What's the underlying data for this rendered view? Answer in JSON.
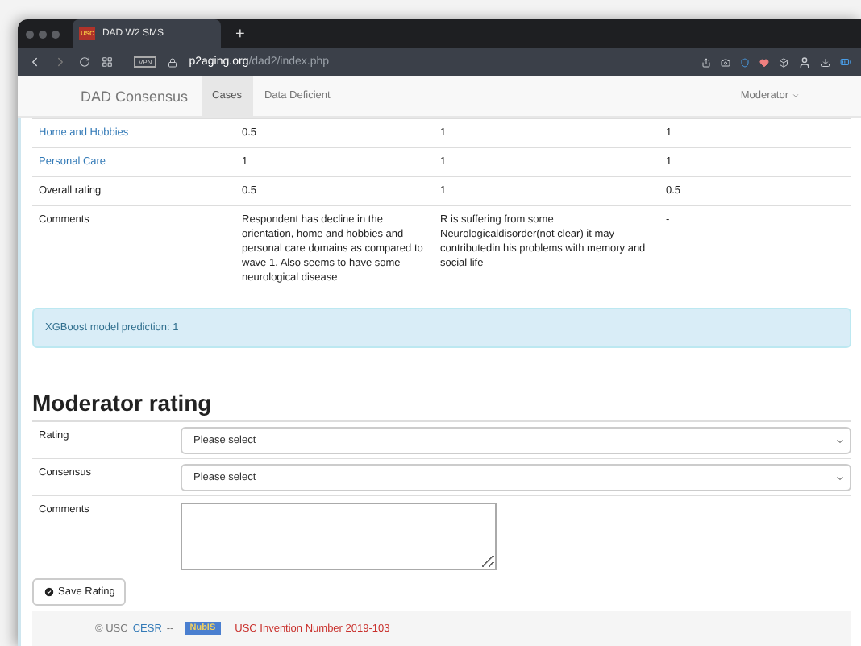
{
  "browser": {
    "favicon": "USC",
    "tab_title": "DAD W2 SMS",
    "new_tab": "+",
    "vpn": "VPN",
    "url_domain": "p2aging.org",
    "url_path": "/dad2/index.php"
  },
  "navbar": {
    "brand": "DAD Consensus",
    "links": [
      {
        "label": "Cases",
        "selected": true
      },
      {
        "label": "Data Deficient",
        "selected": false
      }
    ],
    "user_menu": "Moderator"
  },
  "table": {
    "rows": [
      {
        "label": "Home and Hobbies",
        "kind": "link",
        "values": [
          "0.5",
          "1",
          "1"
        ]
      },
      {
        "label": "Personal Care",
        "kind": "link",
        "values": [
          "1",
          "1",
          "1"
        ]
      },
      {
        "label": "Overall rating",
        "kind": "plain",
        "values": [
          "0.5",
          "1",
          "0.5"
        ]
      },
      {
        "label": "Comments",
        "kind": "plain",
        "values": [
          "Respondent has decline in the orientation, home and hobbies and personal care domains as compared to wave 1. Also seems to have some neurological disease",
          "R is suffering from some Neurologicaldisorder(not clear) it may contributedin his problems with memory and social life",
          "-"
        ]
      }
    ]
  },
  "alert": "XGBoost model prediction: 1",
  "heading": "Moderator rating",
  "form": [
    {
      "label": "Rating",
      "kind": "select",
      "value": "Please select"
    },
    {
      "label": "Consensus",
      "kind": "select",
      "value": "Please select"
    },
    {
      "label": "Comments",
      "kind": "textarea"
    }
  ],
  "save_button": "Save Rating",
  "footer": {
    "copyright": "© USC",
    "link": "CESR",
    "separator": "--",
    "badge": "NubIS",
    "invention": "USC Invention Number 2019-103"
  }
}
